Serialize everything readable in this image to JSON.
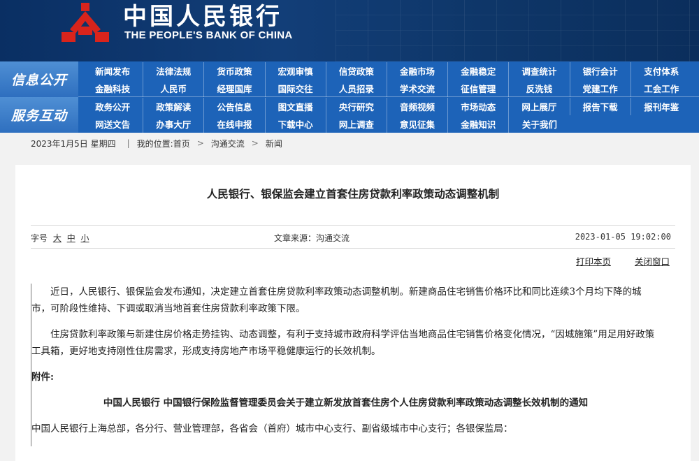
{
  "header": {
    "cn_title": "中国人民银行",
    "en_title": "THE PEOPLE'S BANK OF CHINA",
    "logo_icon": "pboc-logo-icon",
    "colors": {
      "banner": "#0a2f63",
      "nav": "#1d63b8",
      "logo_red": "#d8241c"
    }
  },
  "nav": {
    "section1_label": "信息公开",
    "section2_label": "服务互动",
    "row1": [
      "新闻发布",
      "法律法规",
      "货币政策",
      "宏观审慎",
      "信贷政策",
      "金融市场",
      "金融稳定",
      "调查统计",
      "银行会计",
      "支付体系"
    ],
    "row2": [
      "金融科技",
      "人民币",
      "经理国库",
      "国际交往",
      "人员招录",
      "学术交流",
      "征信管理",
      "反洗钱",
      "党建工作",
      "工会工作"
    ],
    "row3": [
      "政务公开",
      "政策解读",
      "公告信息",
      "图文直播",
      "央行研究",
      "音频视频",
      "市场动态",
      "网上展厅",
      "报告下载",
      "报刊年鉴"
    ],
    "row4": [
      "网送文告",
      "办事大厅",
      "在线申报",
      "下载中心",
      "网上调查",
      "意见征集",
      "金融知识",
      "关于我们"
    ]
  },
  "breadcrumb": {
    "date": "2023年1月5日 星期四",
    "divider": "|",
    "location_label": "我的位置:首页",
    "arrow": ">",
    "level2": "沟通交流",
    "level3": "新闻"
  },
  "article": {
    "title": "人民银行、银保监会建立首套住房贷款利率政策动态调整机制",
    "font_label": "字号",
    "font_large": "大",
    "font_medium": "中",
    "font_small": "小",
    "source": "文章来源：沟通交流",
    "date": "2023-01-05 19:02:00",
    "print_label": "打印本页",
    "close_label": "关闭窗口",
    "paragraphs": [
      "近日，人民银行、银保监会发布通知，决定建立首套住房贷款利率政策动态调整机制。新建商品住宅销售价格环比和同比连续3个月均下降的城市，可阶段性维持、下调或取消当地首套住房贷款利率政策下限。",
      "住房贷款利率政策与新建住房价格走势挂钩、动态调整，有利于支持城市政府科学评估当地商品住宅销售价格变化情况，“因城施策”用足用好政策工具箱，更好地支持刚性住房需求，形成支持房地产市场平稳健康运行的长效机制。"
    ],
    "attachment_label": "附件:",
    "notice_title": "中国人民银行 中国银行保险监督管理委员会关于建立新发放首套住房个人住房贷款利率政策动态调整长效机制的通知",
    "addressee": "中国人民银行上海总部，各分行、营业管理部，各省会（首府）城市中心支行、副省级城市中心支行；各银保监局："
  }
}
